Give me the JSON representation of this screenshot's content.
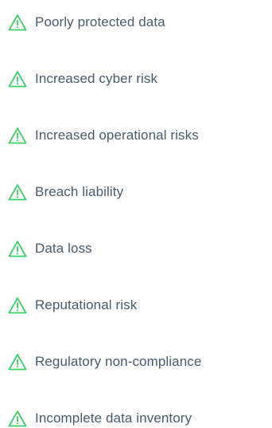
{
  "accent_color": "#3ccf68",
  "text_color": "#4a5a6b",
  "icon": "warning-triangle-icon",
  "items": [
    {
      "label": "Poorly protected data"
    },
    {
      "label": "Increased cyber risk"
    },
    {
      "label": "Increased operational risks"
    },
    {
      "label": "Breach liability"
    },
    {
      "label": "Data loss"
    },
    {
      "label": "Reputational risk"
    },
    {
      "label": "Regulatory non-compliance"
    },
    {
      "label": "Incomplete data inventory"
    }
  ]
}
